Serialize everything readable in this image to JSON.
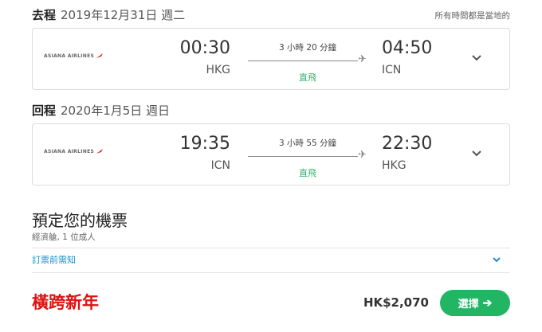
{
  "timezone_note": "所有時間都是當地的",
  "legs": [
    {
      "label": "去程",
      "date": "2019年12月31日 週二",
      "airline": "ASIANA AIRLINES",
      "depart_time": "00:30",
      "depart_code": "HKG",
      "duration": "3 小時 20 分鐘",
      "stops": "直飛",
      "arrive_time": "04:50",
      "arrive_code": "ICN"
    },
    {
      "label": "回程",
      "date": "2020年1月5日 週日",
      "airline": "ASIANA AIRLINES",
      "depart_time": "19:35",
      "depart_code": "ICN",
      "duration": "3 小時 55 分鐘",
      "stops": "直飛",
      "arrive_time": "22:30",
      "arrive_code": "HKG"
    }
  ],
  "booking": {
    "title": "預定您的機票",
    "subtitle": "經濟艙, 1 位成人",
    "notice_link": "訂票前需知"
  },
  "promo_text": "橫跨新年",
  "price": "HK$2,070",
  "select_button": "選擇",
  "colors": {
    "accent_green": "#21b564",
    "nonstop_green": "#2fb36a",
    "link_blue": "#1a8fc9",
    "promo_red": "#e01010",
    "airline_red": "#e0272f"
  },
  "icons": {
    "plane": "plane-icon",
    "expand": "chevron-down-icon",
    "arrow": "arrow-right-icon"
  }
}
